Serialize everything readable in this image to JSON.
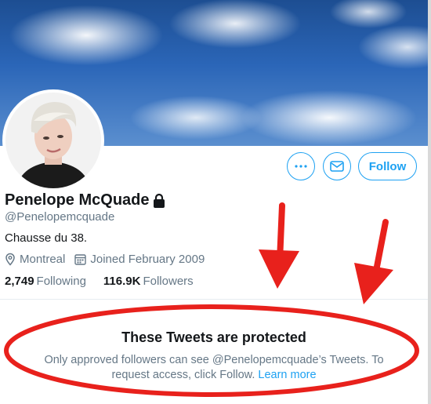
{
  "profile": {
    "name": "Penelope McQuade",
    "handle": "@Penelopemcquade",
    "bio": "Chausse du 38.",
    "location": "Montreal",
    "joined": "Joined February 2009",
    "following_count": "2,749",
    "following_label": "Following",
    "followers_count": "116.9K",
    "followers_label": "Followers"
  },
  "actions": {
    "more_icon": "more-icon",
    "message_icon": "mail-icon",
    "follow_label": "Follow"
  },
  "protected": {
    "title": "These Tweets are protected",
    "body": "Only approved followers can see @Penelopemcquade’s Tweets. To request access, click Follow.",
    "link": "Learn more"
  },
  "colors": {
    "accent": "#1da1f2",
    "annotation": "#e8211c"
  }
}
